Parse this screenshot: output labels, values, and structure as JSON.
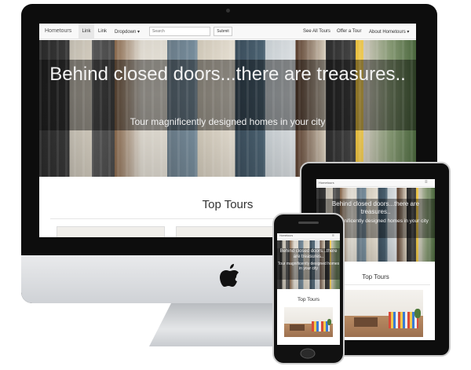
{
  "site": {
    "brand": "Hometours",
    "nav_links": [
      "Link",
      "Link",
      "Dropdown ▾"
    ],
    "search_placeholder": "Search",
    "submit_label": "Submit",
    "right_links": [
      "See All Tours",
      "Offer a Tour",
      "About Hometours ▾"
    ],
    "hero_title": "Behind closed doors...there are treasures..",
    "hero_subtitle": "Tour magnificently designed homes in your city",
    "section_title": "Top Tours"
  },
  "tablet": {
    "brand": "Hometours",
    "hero_title": "Behind closed doors...there are treasures..",
    "hero_subtitle": "Tour magnificently designed homes in your city",
    "section_title": "Top Tours"
  },
  "phone": {
    "brand": "Hometours",
    "hero_title": "Behind closed doors...there are treasures..",
    "hero_subtitle": "Tour magnificently designed homes in your city",
    "section_title": "Top Tours"
  },
  "icons": {
    "apple": "apple-logo",
    "menu": "hamburger-menu"
  },
  "colors": {
    "bezel": "#0d0d0d",
    "nav_bg": "#f8f8f8",
    "hero_overlay": "rgba(0,0,0,0.42)",
    "text": "#333333"
  }
}
